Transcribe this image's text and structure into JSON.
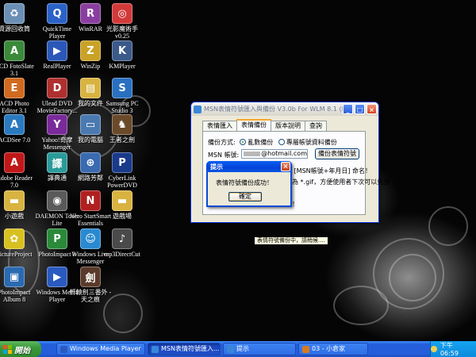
{
  "desktop": {
    "icons": [
      {
        "label": "資源回收筒",
        "icon": "recycle-bin-icon",
        "color": "#6b8fb5",
        "glyph": "♻"
      },
      {
        "label": "QuickTime Player",
        "icon": "quicktime-icon",
        "color": "#2a62c8",
        "glyph": "Q"
      },
      {
        "label": "WinRAR",
        "icon": "winrar-icon",
        "color": "#8a3fa0",
        "glyph": "R"
      },
      {
        "label": "光影魔術手 v0.25",
        "icon": "photo-tool-icon",
        "color": "#d23a3a",
        "glyph": "◎"
      },
      {
        "label": "ACD FotoSlate 3.1",
        "icon": "acd-fotoslate-icon",
        "color": "#3a8a3a",
        "glyph": "A"
      },
      {
        "label": "RealPlayer",
        "icon": "realplayer-icon",
        "color": "#2b58b8",
        "glyph": "▶"
      },
      {
        "label": "WinZip",
        "icon": "winzip-icon",
        "color": "#c9a227",
        "glyph": "Z"
      },
      {
        "label": "KMPlayer",
        "icon": "kmplayer-icon",
        "color": "#3b5a8a",
        "glyph": "K"
      },
      {
        "label": "ACD Photo Editor 3.1",
        "icon": "acd-photo-editor-icon",
        "color": "#d06a20",
        "glyph": "E"
      },
      {
        "label": "Ulead DVD MovieFactory...",
        "icon": "ulead-dvd-icon",
        "color": "#b03030",
        "glyph": "D"
      },
      {
        "label": "我的文件",
        "icon": "my-documents-icon",
        "color": "#d8b340",
        "glyph": "▤"
      },
      {
        "label": "Samsung PC Studio 3",
        "icon": "samsung-pc-studio-icon",
        "color": "#2a70c0",
        "glyph": "S"
      },
      {
        "label": "ACDSee 7.0",
        "icon": "acdsee-icon",
        "color": "#2a7ac0",
        "glyph": "A"
      },
      {
        "label": "Yahoo!奇摩 Messenger",
        "icon": "yahoo-messenger-icon",
        "color": "#7a2a9a",
        "glyph": "Y"
      },
      {
        "label": "我的電腦",
        "icon": "my-computer-icon",
        "color": "#4a7ab0",
        "glyph": "▭"
      },
      {
        "label": "王者之劍",
        "icon": "game-icon",
        "color": "#6a4a2a",
        "glyph": "♞"
      },
      {
        "label": "Adobe Reader 7.0",
        "icon": "adobe-reader-icon",
        "color": "#c01818",
        "glyph": "A"
      },
      {
        "label": "譯典通",
        "icon": "dictionary-icon",
        "color": "#2a9a9a",
        "glyph": "譯"
      },
      {
        "label": "網路芳鄰",
        "icon": "network-icon",
        "color": "#3a6ab0",
        "glyph": "⊕"
      },
      {
        "label": "CyberLink PowerDVD",
        "icon": "powerdvd-icon",
        "color": "#1a3a8a",
        "glyph": "P"
      },
      {
        "label": "小遊戲",
        "icon": "folder-icon",
        "color": "#d8b340",
        "glyph": "▬"
      },
      {
        "label": "DAEMON Tools Lite",
        "icon": "daemon-tools-icon",
        "color": "#5a5a5a",
        "glyph": "◉"
      },
      {
        "label": "Nero StartSmart Essentials",
        "icon": "nero-icon",
        "color": "#b02020",
        "glyph": "N"
      },
      {
        "label": "遊戲場",
        "icon": "folder-icon",
        "color": "#d8b340",
        "glyph": "▬"
      },
      {
        "label": "PictureProject",
        "icon": "pictureproject-icon",
        "color": "#d8c020",
        "glyph": "✿"
      },
      {
        "label": "PhotoImpact 8",
        "icon": "photoimpact-icon",
        "color": "#2a8a3a",
        "glyph": "P"
      },
      {
        "label": "Windows Live Messenger",
        "icon": "live-messenger-icon",
        "color": "#2a8ad0",
        "glyph": "☺"
      },
      {
        "label": "mp3DirectCut",
        "icon": "mp3directcut-icon",
        "color": "#4a4a4a",
        "glyph": "♪"
      },
      {
        "label": "PhotoImpact Album 8",
        "icon": "photoimpact-album-icon",
        "color": "#2a6ab0",
        "glyph": "▣"
      },
      {
        "label": "Windows Media Player",
        "icon": "media-player-icon",
        "color": "#2a5ac0",
        "glyph": "▶"
      },
      {
        "label": "軒轅劍三番外 -天之痕",
        "icon": "game-icon",
        "color": "#5a3a2a",
        "glyph": "劍"
      }
    ]
  },
  "msn_window": {
    "title": "MSN表情符號匯入與備份 V3.0b For WLM 8.1 (Bet",
    "min_label": "_",
    "max_label": "□",
    "close_label": "×",
    "tabs": [
      "表情匯入",
      "表情備份",
      "版本說明",
      "查詢"
    ],
    "backup_mode_label": "備份方式:",
    "radio_1": "亂數備份",
    "radio_2": "專屬帳號資料備份",
    "account_label": "MSN 帳號:",
    "account_suffix": "@hotmail.com",
    "backup_button": "備份表情符號",
    "info_line_1": "並以 [MSN帳號+年月日] 命名！",
    "info_line_2": "檔名為 *.gif，方便使用者下次可以先預",
    "info_line_3": "閱！",
    "info_line_4": "開啟！"
  },
  "dialog": {
    "title": "提示",
    "close_label": "×",
    "message": "表情符號備份成功！",
    "ok_label": "確定"
  },
  "tooltip": {
    "text": "表情符號備份中，請稍候...."
  },
  "taskbar": {
    "start_label": "開始",
    "tasks": [
      {
        "label": "Windows Media Player",
        "color": "#2a5ac0",
        "icon": "media-player-icon"
      },
      {
        "label": "MSN表情符號匯入...",
        "color": "#3a86d8",
        "icon": "msn-app-icon"
      },
      {
        "label": "提示",
        "color": "#3a86d8",
        "icon": "dialog-app-icon"
      },
      {
        "label": "03 - 小倉家",
        "color": "#d87a20",
        "icon": "music-app-icon"
      }
    ],
    "clock": "下午 06:59"
  }
}
